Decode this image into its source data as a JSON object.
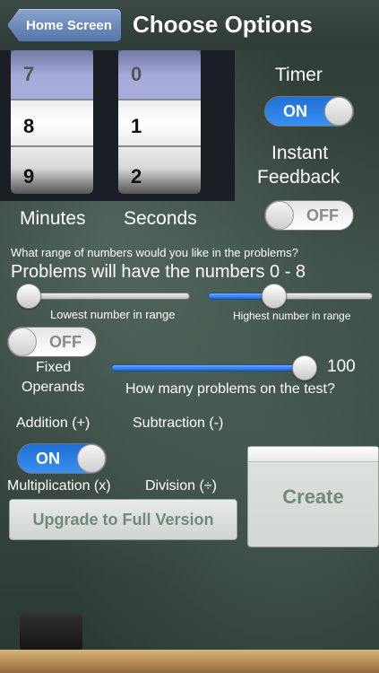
{
  "nav": {
    "back_label": "Home Screen",
    "title": "Choose Options"
  },
  "picker": {
    "minutes": [
      "7",
      "8",
      "9"
    ],
    "seconds": [
      "0",
      "1",
      "2"
    ],
    "minutes_label": "Minutes",
    "seconds_label": "Seconds"
  },
  "timer": {
    "label": "Timer",
    "state": "ON"
  },
  "instant_feedback": {
    "label_line1": "Instant",
    "label_line2": "Feedback",
    "state": "OFF"
  },
  "range": {
    "question": "What range of numbers would you like in the problems?",
    "summary": "Problems will have the numbers 0 - 8",
    "low_label": "Lowest number in range",
    "high_label": "Highest number in range"
  },
  "fixed_operands": {
    "label_line1": "Fixed",
    "label_line2": "Operands",
    "state": "OFF"
  },
  "problems": {
    "count": "100",
    "label": "How many problems on the test?"
  },
  "operations": {
    "addition": "Addition (+)",
    "subtraction": "Subtraction (-)",
    "multiplication": "Multiplication (x)",
    "division": "Division (÷)",
    "addition_state": "ON"
  },
  "actions": {
    "upgrade": "Upgrade to Full Version",
    "create": "Create"
  },
  "colors": {
    "toggle_on": "#1e6fd6",
    "button_text": "#6f8a79",
    "chalkboard": "#34433c"
  }
}
